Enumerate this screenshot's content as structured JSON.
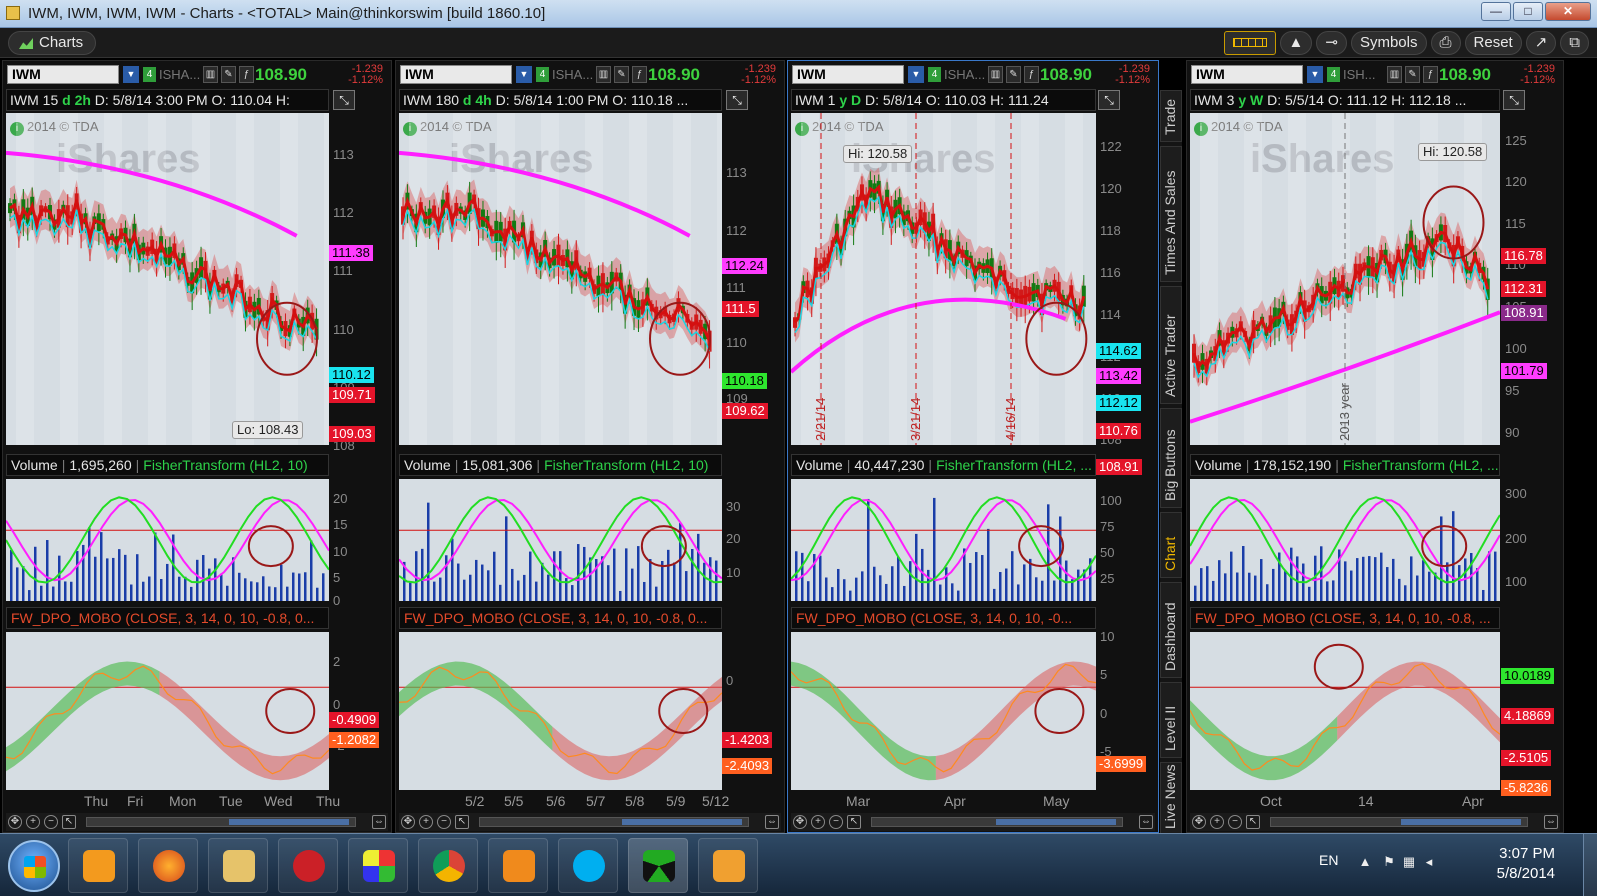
{
  "window": {
    "title": "IWM, IWM, IWM, IWM - Charts - <TOTAL> Main@thinkorswim [build 1860.10]",
    "buttons": [
      "—",
      "□",
      "✕"
    ]
  },
  "toolbar": {
    "tab_label": "Charts",
    "symbols_label": "Symbols",
    "reset_label": "Reset"
  },
  "panels": [
    {
      "symbol": "IWM",
      "group": "4",
      "desc": "ISHA...",
      "last": "108.90",
      "chg1": "-1.239",
      "chg2": "-1.12%",
      "info": {
        "tf_pre": "IWM 15 ",
        "tf": "d 2h",
        "rest": " D: 5/8/14 3:00 PM  O: 110.04  H:"
      },
      "copyright": "2014 © TDA",
      "watermark": "iShares",
      "price_axis": [
        "113",
        "112",
        "111",
        "110",
        "109",
        "108"
      ],
      "price_tags": [
        {
          "text": "111.38",
          "bg": "#ff3cff",
          "fg": "#000"
        },
        {
          "text": "110.12",
          "bg": "#19e4ef",
          "fg": "#000"
        },
        {
          "text": "109.71",
          "bg": "#e4142a",
          "fg": "#fff"
        },
        {
          "text": "109.03",
          "bg": "#e4142a",
          "fg": "#fff"
        }
      ],
      "hilo": [
        {
          "text": "Lo: 108.43"
        }
      ],
      "date_labels": [],
      "volume_label": "Volume",
      "volume_value": "1,695,260",
      "fisher_label": "FisherTransform (HL2, 10)",
      "vol_axis": [
        "20",
        "15",
        "10",
        "5",
        "0"
      ],
      "dpo_label": "FW_DPO_MOBO (CLOSE, 3, 14, 0, 10, -0.8, 0...",
      "dpo_axis": [
        "2",
        "0",
        "-2"
      ],
      "dpo_tags": [
        {
          "text": "-0.4909",
          "bg": "#e4142a",
          "fg": "#fff"
        },
        {
          "text": "-1.2082",
          "bg": "#ff5f1f",
          "fg": "#fff"
        }
      ],
      "x_axis": [
        "Thu",
        "Fri",
        "Mon",
        "Tue",
        "Wed",
        "Thu"
      ]
    },
    {
      "symbol": "IWM",
      "group": "4",
      "desc": "ISHA...",
      "last": "108.90",
      "chg1": "-1.239",
      "chg2": "-1.12%",
      "info": {
        "tf_pre": "IWM 180 ",
        "tf": "d 4h",
        "rest": " D: 5/8/14 1:00 PM  O: 110.18  ..."
      },
      "copyright": "2014 © TDA",
      "watermark": "iShares",
      "price_axis": [
        "113",
        "112",
        "111",
        "110",
        "109"
      ],
      "price_tags": [
        {
          "text": "112.24",
          "bg": "#ff3cff",
          "fg": "#000"
        },
        {
          "text": "111.5",
          "bg": "#e4142a",
          "fg": "#fff"
        },
        {
          "text": "110.18",
          "bg": "#2ee62e",
          "fg": "#000"
        },
        {
          "text": "109.62",
          "bg": "#e4142a",
          "fg": "#fff"
        }
      ],
      "hilo": [],
      "date_labels": [],
      "volume_label": "Volume",
      "volume_value": "15,081,306",
      "fisher_label": "FisherTransform (HL2, 10)",
      "vol_axis": [
        "30",
        "20",
        "10"
      ],
      "dpo_label": "FW_DPO_MOBO (CLOSE, 3, 14, 0, 10, -0.8, 0...",
      "dpo_axis": [
        "0"
      ],
      "dpo_tags": [
        {
          "text": "-1.4203",
          "bg": "#e4142a",
          "fg": "#fff"
        },
        {
          "text": "-2.4093",
          "bg": "#ff5f1f",
          "fg": "#fff"
        }
      ],
      "x_axis": [
        "5/2",
        "5/5",
        "5/6",
        "5/7",
        "5/8",
        "5/9",
        "5/12"
      ]
    },
    {
      "symbol": "IWM",
      "group": "4",
      "desc": "ISHA...",
      "last": "108.90",
      "chg1": "-1.239",
      "chg2": "-1.12%",
      "info": {
        "tf_pre": "IWM 1 ",
        "tf": "y D",
        "rest": "  D: 5/8/14  O: 110.03  H: 111.24"
      },
      "copyright": "2014 © TDA",
      "watermark": "iShares",
      "price_axis": [
        "122",
        "120",
        "118",
        "116",
        "114",
        "112",
        "110",
        "108"
      ],
      "price_tags": [
        {
          "text": "114.62",
          "bg": "#19e4ef",
          "fg": "#000"
        },
        {
          "text": "113.42",
          "bg": "#ff3cff",
          "fg": "#000"
        },
        {
          "text": "112.12",
          "bg": "#19e4ef",
          "fg": "#000"
        },
        {
          "text": "110.76",
          "bg": "#e4142a",
          "fg": "#fff"
        },
        {
          "text": "108.91",
          "bg": "#e4142a",
          "fg": "#fff"
        }
      ],
      "hilo": [
        {
          "text": "Hi: 120.58"
        }
      ],
      "date_labels": [
        "2/21/14",
        "3/21/14",
        "4/16/14"
      ],
      "volume_label": "Volume",
      "volume_value": "40,447,230",
      "fisher_label": "FisherTransform (HL2, ...",
      "vol_axis": [
        "100",
        "75",
        "50",
        "25"
      ],
      "dpo_label": "FW_DPO_MOBO (CLOSE, 3, 14, 0, 10, -0...",
      "dpo_axis": [
        "10",
        "5",
        "0",
        "-5"
      ],
      "dpo_tags": [
        {
          "text": "-3.6999",
          "bg": "#ff5f1f",
          "fg": "#fff"
        }
      ],
      "x_axis": [
        "Mar",
        "Apr",
        "May"
      ]
    },
    {
      "symbol": "IWM",
      "group": "4",
      "desc": "ISH...",
      "last": "108.90",
      "chg1": "-1.239",
      "chg2": "-1.12%",
      "info": {
        "tf_pre": "IWM 3 ",
        "tf": "y W",
        "rest": "  D: 5/5/14  O: 111.12  H: 112.18  ..."
      },
      "copyright": "2014 © TDA",
      "watermark": "iShares",
      "price_axis": [
        "125",
        "120",
        "115",
        "110",
        "105",
        "100",
        "95",
        "90"
      ],
      "price_tags": [
        {
          "text": "116.78",
          "bg": "#e4142a",
          "fg": "#fff"
        },
        {
          "text": "112.31",
          "bg": "#e4142a",
          "fg": "#fff"
        },
        {
          "text": "108.91",
          "bg": "#8a2a8a",
          "fg": "#fff"
        },
        {
          "text": "101.79",
          "bg": "#ff3cff",
          "fg": "#000"
        }
      ],
      "hilo": [
        {
          "text": "Hi: 120.58"
        }
      ],
      "date_labels": [
        "2013 year"
      ],
      "volume_label": "Volume",
      "volume_value": "178,152,190",
      "fisher_label": "FisherTransform (HL2, ...",
      "vol_axis": [
        "300",
        "200",
        "100"
      ],
      "dpo_label": "FW_DPO_MOBO (CLOSE, 3, 14, 0, 10, -0.8, ...",
      "dpo_axis": [],
      "dpo_tags": [
        {
          "text": "10.0189",
          "bg": "#2ee62e",
          "fg": "#000"
        },
        {
          "text": "4.18869",
          "bg": "#e4142a",
          "fg": "#fff"
        },
        {
          "text": "-2.5105",
          "bg": "#e4142a",
          "fg": "#fff"
        },
        {
          "text": "-5.8236",
          "bg": "#ff5f1f",
          "fg": "#fff"
        }
      ],
      "x_axis": [
        "Oct",
        "14",
        "Apr"
      ]
    }
  ],
  "side_tabs": [
    "Trade",
    "Times And Sales",
    "Active Trader",
    "Big Buttons",
    "Chart",
    "Dashboard",
    "Level II",
    "Live News"
  ],
  "taskbar": {
    "lang": "EN",
    "time": "3:07 PM",
    "date": "5/8/2014"
  }
}
